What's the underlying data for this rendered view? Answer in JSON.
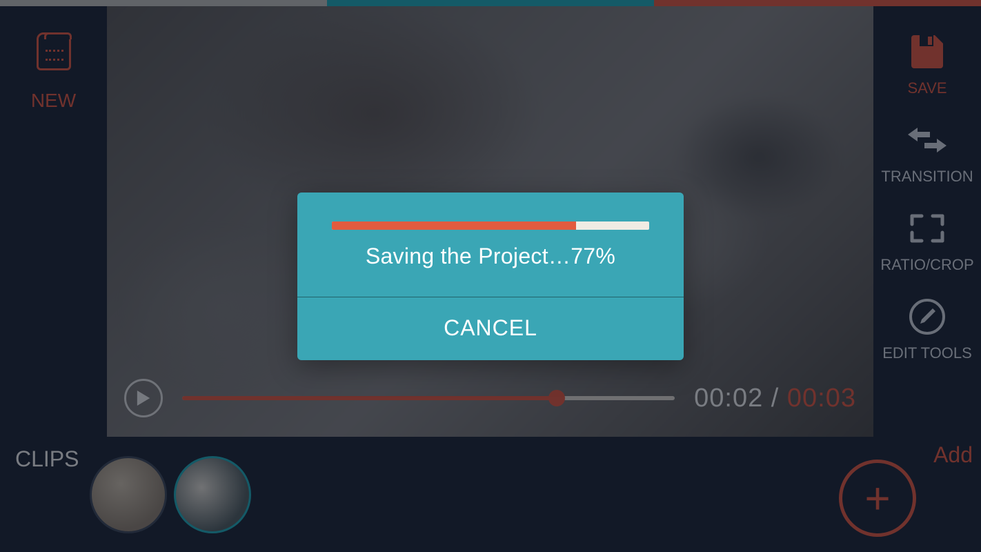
{
  "left": {
    "new_label": "NEW"
  },
  "right": {
    "save_label": "SAVE",
    "transition_label": "TRANSITION",
    "ratio_label": "RATIO/CROP",
    "edit_label": "EDIT TOOLS"
  },
  "playback": {
    "current": "00:02",
    "sep": " / ",
    "total": "00:03",
    "seek_percent": 76
  },
  "clips": {
    "label": "CLIPS",
    "add_label": "Add"
  },
  "dialog": {
    "progress_percent": 77,
    "message": "Saving the Project…77%",
    "cancel_label": "CANCEL"
  },
  "colors": {
    "accent": "#d9553f",
    "teal": "#3aa6b5"
  }
}
